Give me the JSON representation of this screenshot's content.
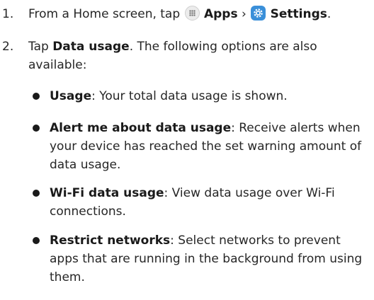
{
  "steps": [
    {
      "number": "1.",
      "prefix": "From a Home screen, tap",
      "apps_label": "Apps",
      "separator": "›",
      "settings_label": "Settings",
      "suffix": "."
    },
    {
      "number": "2.",
      "prefix": "Tap",
      "bold": "Data usage",
      "suffix": ". The following options are also available:"
    }
  ],
  "options": [
    {
      "title": "Usage",
      "desc": ": Your total data usage is shown."
    },
    {
      "title": "Alert me about data usage",
      "desc": ": Receive alerts when your device has reached the set warning amount of data usage."
    },
    {
      "title": "Wi-Fi data usage",
      "desc": ": View data usage over Wi-Fi connections."
    },
    {
      "title": "Restrict networks",
      "desc": ": Select networks to prevent apps that are running in the background from using them."
    }
  ],
  "icons": {
    "apps": "apps-grid-icon",
    "settings": "settings-gear-icon"
  },
  "colors": {
    "settings_icon_bg": "#3a8fd9",
    "text": "#262626"
  }
}
